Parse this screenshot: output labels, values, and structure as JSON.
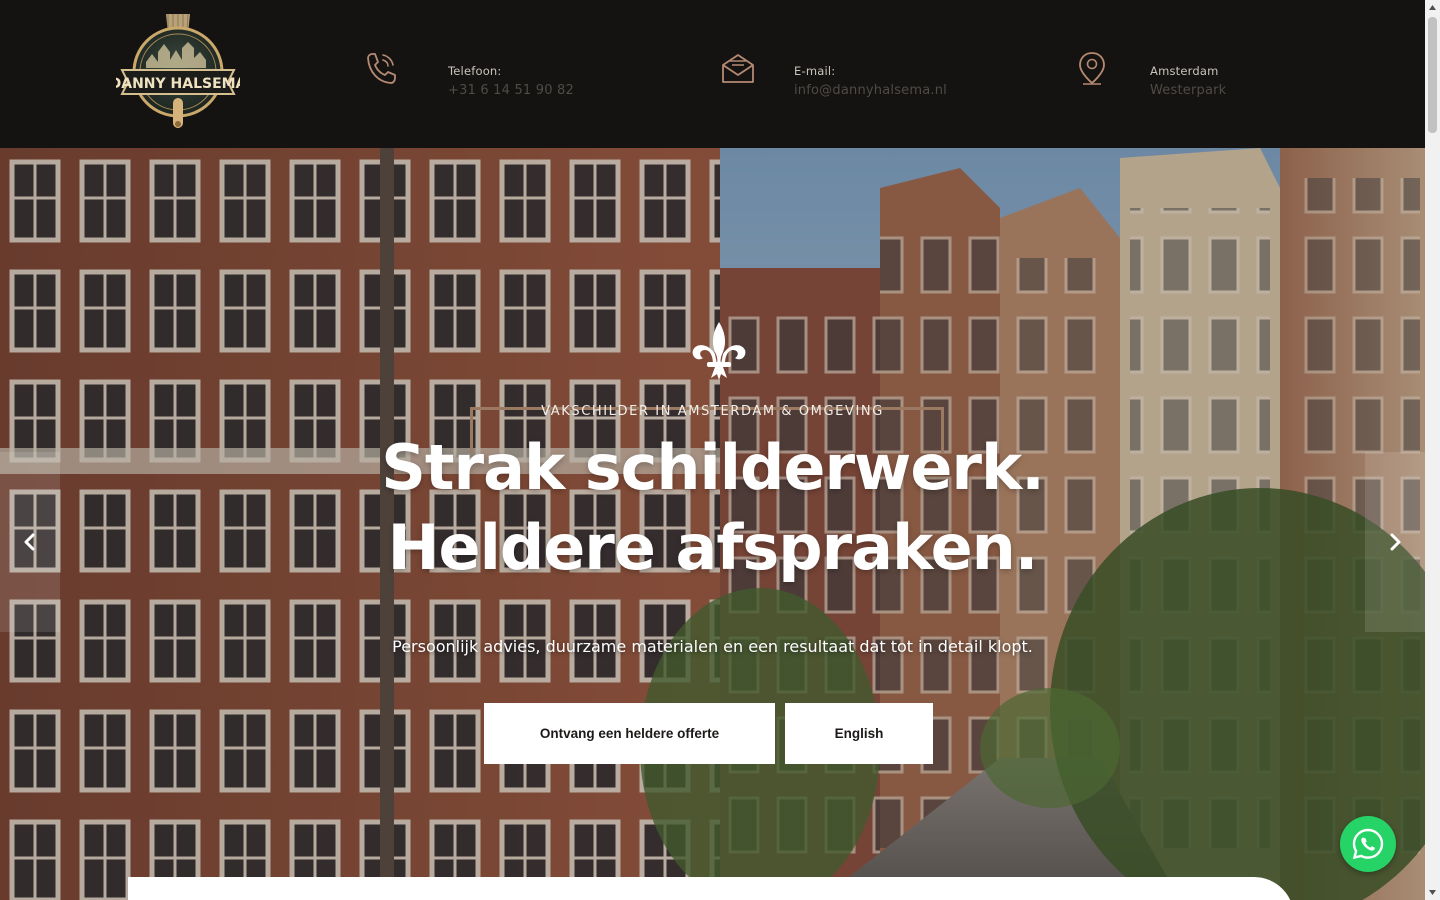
{
  "brand": {
    "logo_text": "DANNY HALSEMA"
  },
  "contacts": [
    {
      "icon": "phone-icon",
      "label": "Telefoon:",
      "value": "+31 6 14 51 90 82"
    },
    {
      "icon": "envelope-icon",
      "label": "E-mail:",
      "value": "info@dannyhalsema.nl"
    },
    {
      "icon": "map-pin-icon",
      "label": "Amsterdam",
      "value": "Westerpark"
    }
  ],
  "hero": {
    "tagline": "VAKSCHILDER IN AMSTERDAM & OMGEVING",
    "headline_line1": "Strak schilderwerk.",
    "headline_line2": "Heldere afspraken.",
    "subline": "Persoonlijk advies, duurzame materialen en een resultaat dat tot in detail klopt.",
    "primary_button": "Ontvang een heldere offerte",
    "secondary_button": "English"
  },
  "colors": {
    "header_bg": "#151311",
    "accent_bronze": "#9c7a62",
    "whatsapp_green": "#25d366"
  }
}
